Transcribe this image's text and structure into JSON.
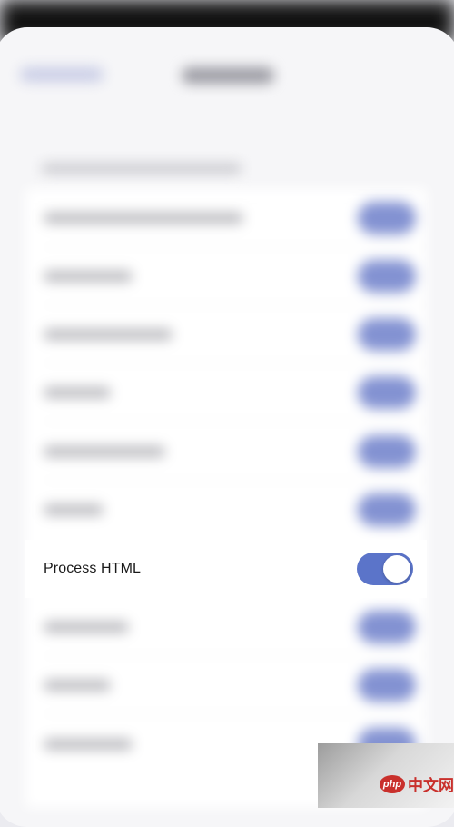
{
  "focused_setting": {
    "label": "Process HTML",
    "enabled": true
  },
  "colors": {
    "toggle_on": "#5b74c9",
    "toggle_on_blurred": "#8392d2",
    "background": "#f6f6f8",
    "watermark_red": "#c9302c"
  },
  "watermark": {
    "logo_text": "php",
    "text": "中文网"
  }
}
